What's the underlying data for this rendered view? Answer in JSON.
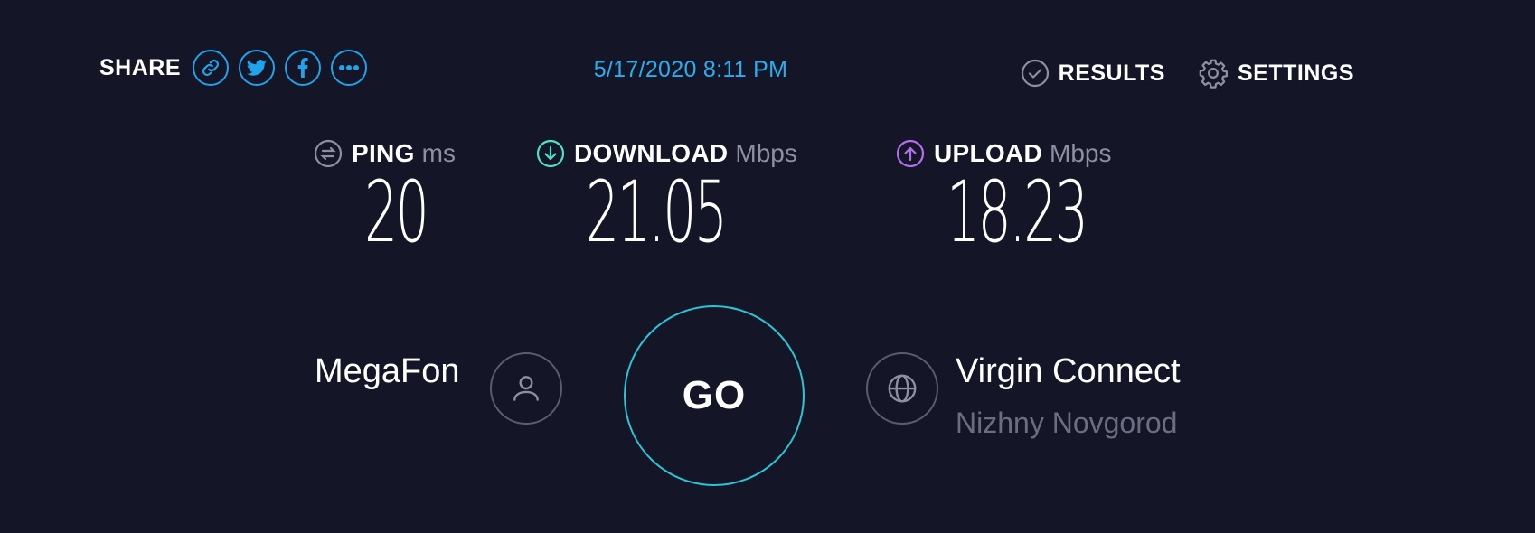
{
  "share": {
    "label": "SHARE",
    "buttons": [
      {
        "icon": "link-icon"
      },
      {
        "icon": "twitter-icon"
      },
      {
        "icon": "facebook-icon"
      },
      {
        "icon": "more-icon"
      }
    ]
  },
  "datetime": "5/17/2020 8:11 PM",
  "nav": {
    "results_label": "RESULTS",
    "settings_label": "SETTINGS"
  },
  "metrics": {
    "ping": {
      "label": "PING",
      "unit": "ms",
      "value": "20",
      "icon": "ping-icon",
      "color": "#8e8fa3"
    },
    "download": {
      "label": "DOWNLOAD",
      "unit": "Mbps",
      "value": "21.05",
      "icon": "download-arrow-icon",
      "color": "#4fe0c8"
    },
    "upload": {
      "label": "UPLOAD",
      "unit": "Mbps",
      "value": "18.23",
      "icon": "upload-arrow-icon",
      "color": "#b36ef0"
    }
  },
  "isp": {
    "name": "MegaFon",
    "icon": "user-icon"
  },
  "go_label": "GO",
  "server": {
    "name": "Virgin Connect",
    "location": "Nizhny Novgorod",
    "icon": "globe-icon"
  },
  "colors": {
    "background": "#141526",
    "accent": "#1fa3ea",
    "go_ring": "#2ac6d6",
    "muted": "#6c6d80"
  }
}
